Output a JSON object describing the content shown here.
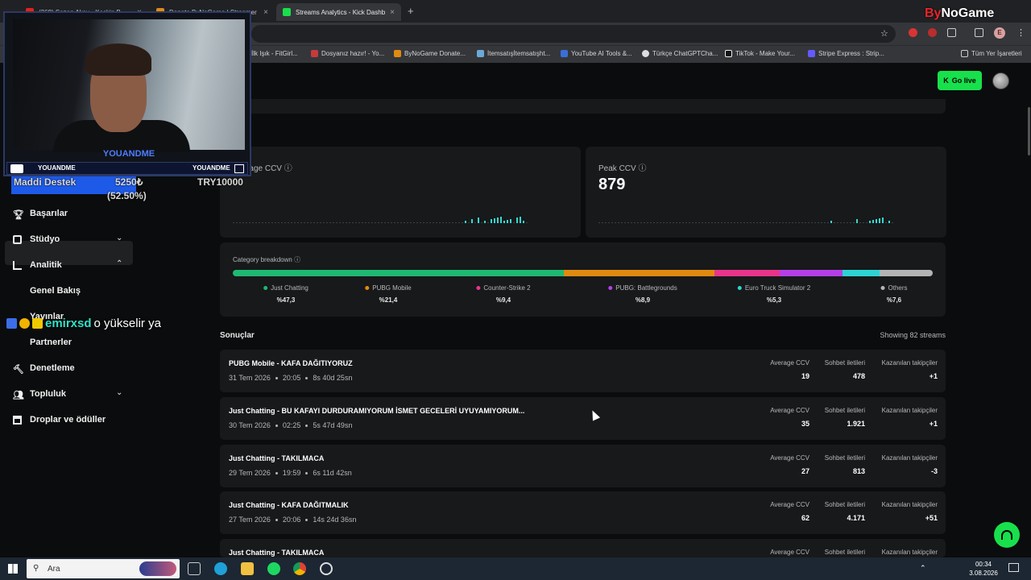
{
  "browser": {
    "tabs": [
      {
        "label": "(369) Sezen Aksu - Keskin B"
      },
      {
        "label": "Donate ByNoGame | Streamer"
      },
      {
        "label": "Streams Analytics - Kick Dashb"
      }
    ],
    "bookmarks": [
      "İlk Işık - FitGirl...",
      "Dosyanız hazır! - Yo...",
      "ByNoGame Donate...",
      "İtemsatışİtemsatışht...",
      "YouTube AI Tools &...",
      "Türkçe ChatGPTCha...",
      "TikTok - Make Your...",
      "Stripe Express : Strip...",
      "Tüm Yer İşaretleri"
    ]
  },
  "header": {
    "go_live": "Go live"
  },
  "stats": {
    "avg_label": "Average CCV",
    "peak_label": "Peak CCV",
    "peak_value": "879"
  },
  "categories": {
    "title": "Category breakdown",
    "items": [
      {
        "name": "Just Chatting",
        "pct_label": "%47,3",
        "pct": 47.3,
        "color": "#1fb872"
      },
      {
        "name": "PUBG Mobile",
        "pct_label": "%21,4",
        "pct": 21.4,
        "color": "#e08a12"
      },
      {
        "name": "Counter-Strike 2",
        "pct_label": "%9,4",
        "pct": 9.4,
        "color": "#e8348a"
      },
      {
        "name": "PUBG: Battlegrounds",
        "pct_label": "%8,9",
        "pct": 8.9,
        "color": "#b43fe8"
      },
      {
        "name": "Euro Truck Simulator 2",
        "pct_label": "%5,3",
        "pct": 5.3,
        "color": "#2dd3d3"
      },
      {
        "name": "Others",
        "pct_label": "%7,6",
        "pct": 7.6,
        "color": "#b4b4b4"
      }
    ]
  },
  "results": {
    "heading": "Sonuçlar",
    "showing": "Showing 82 streams",
    "col_avg": "Average CCV",
    "col_chat": "Sohbet iletileri",
    "col_follow": "Kazanılan takipçiler",
    "rows": [
      {
        "title": "PUBG Mobile - KAFA DAĞITIYORUZ",
        "date": "31 Tem 2026",
        "time": "20:05",
        "duration": "8s 40d 25sn",
        "avg": "19",
        "chat": "478",
        "follow": "+1"
      },
      {
        "title": "Just Chatting - BU KAFAYI DURDURAMIYORUM İSMET GECELERİ UYUYAMIYORUM...",
        "date": "30 Tem 2026",
        "time": "02:25",
        "duration": "5s 47d 49sn",
        "avg": "35",
        "chat": "1.921",
        "follow": "+1"
      },
      {
        "title": "Just Chatting - TAKILMACA",
        "date": "29 Tem 2026",
        "time": "19:59",
        "duration": "6s 11d 42sn",
        "avg": "27",
        "chat": "813",
        "follow": "-3"
      },
      {
        "title": "Just Chatting - KAFA DAĞITMALIK",
        "date": "27 Tem 2026",
        "time": "20:06",
        "duration": "14s 24d 36sn",
        "avg": "62",
        "chat": "4.171",
        "follow": "+51"
      },
      {
        "title": "Just Chatting - TAKILMACA",
        "date": "",
        "time": "",
        "duration": "",
        "avg": "",
        "chat": "",
        "follow": ""
      }
    ]
  },
  "sidebar": {
    "donation": {
      "label": "Maddi Destek",
      "amount": "5250₺",
      "goal": "TRY10000",
      "percent_label": "(52.50%)",
      "progress": 0.525
    },
    "items": [
      {
        "label": "Başarılar"
      },
      {
        "label": "Stüdyo"
      },
      {
        "label": "Analitik"
      },
      {
        "label": "Genel Bakış"
      },
      {
        "label": "Yayınlar"
      },
      {
        "label": "Partnerler"
      },
      {
        "label": "Denetleme"
      },
      {
        "label": "Topluluk"
      },
      {
        "label": "Droplar ve ödüller"
      }
    ]
  },
  "overlay": {
    "cam_name": "YOUANDME",
    "cam_left": "YOUANDME",
    "cam_right": "YOUANDME",
    "chat_user": "emirxsd",
    "chat_msg": "o yükselir ya",
    "logo_prefix": "By",
    "logo_rest": "NoGame"
  },
  "taskbar": {
    "search": "Ara",
    "time": "00:34",
    "date": "3.08.2026"
  }
}
